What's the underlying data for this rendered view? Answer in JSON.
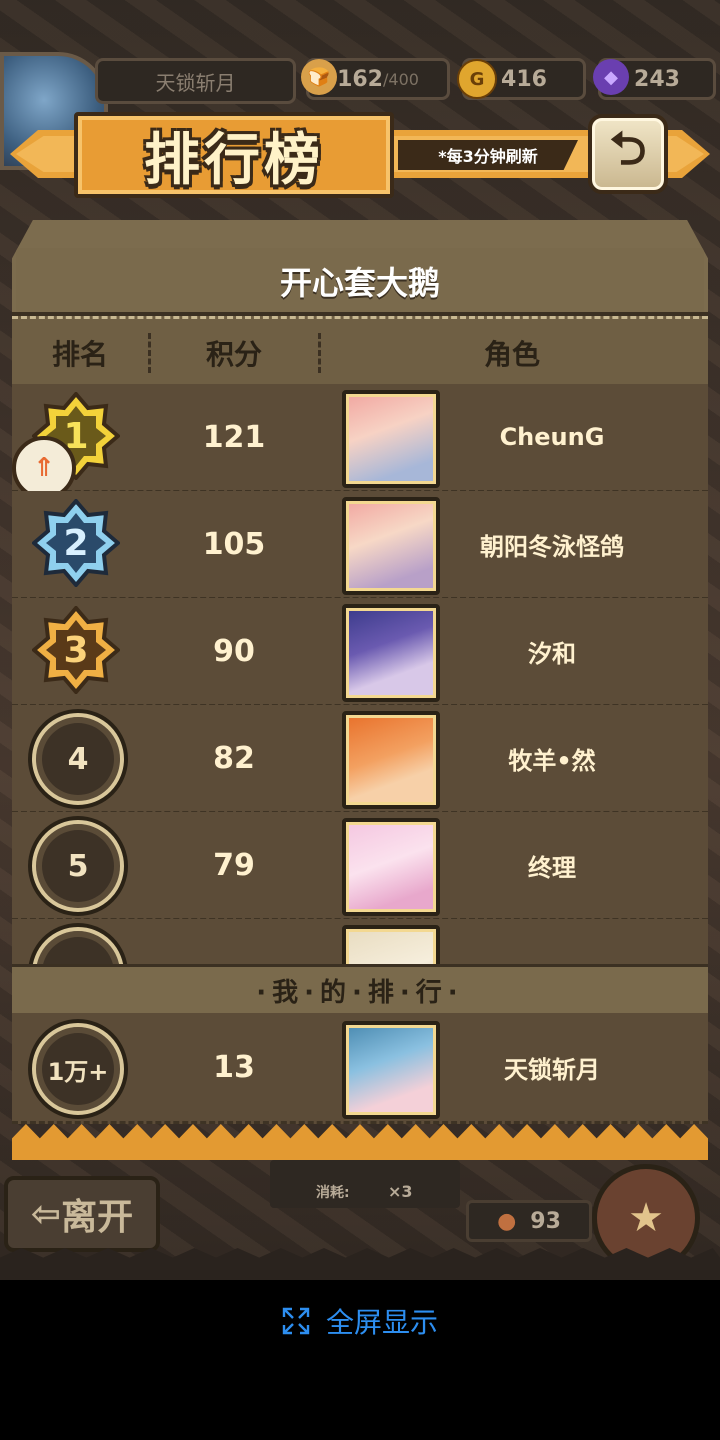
{
  "top_bar": {
    "player_name": "天锁斩月",
    "stamina": "162",
    "stamina_max": "/400",
    "gold": "416",
    "gems": "243"
  },
  "header": {
    "title": "排行榜",
    "refresh_note": "*每3分钟刷新",
    "back_icon": "return-arrow-icon"
  },
  "board": {
    "title": "开心套大鹅",
    "columns": {
      "rank": "排名",
      "score": "积分",
      "character": "角色"
    },
    "rows": [
      {
        "rank": "1",
        "score": "121",
        "name": "CheunG"
      },
      {
        "rank": "2",
        "score": "105",
        "name": "朝阳冬泳怪鸽"
      },
      {
        "rank": "3",
        "score": "90",
        "name": "汐和"
      },
      {
        "rank": "4",
        "score": "82",
        "name": "牧羊•然"
      },
      {
        "rank": "5",
        "score": "79",
        "name": "终理"
      }
    ],
    "my_rank_label": "·我·的·排·行·",
    "my_rank": {
      "rank": "1万+",
      "score": "13",
      "name": "天锁斩月"
    }
  },
  "footer_game": {
    "leave_label": "离开",
    "cost_label": "消耗:",
    "cost_amount": "×3",
    "coins": "93"
  },
  "system": {
    "fullscreen_label": "全屏显示"
  },
  "colors": {
    "accent_orange": "#e9a33a",
    "panel_brown": "#5c4c38",
    "text_cream": "#fff1cf",
    "link_blue": "#2d8ef0"
  }
}
